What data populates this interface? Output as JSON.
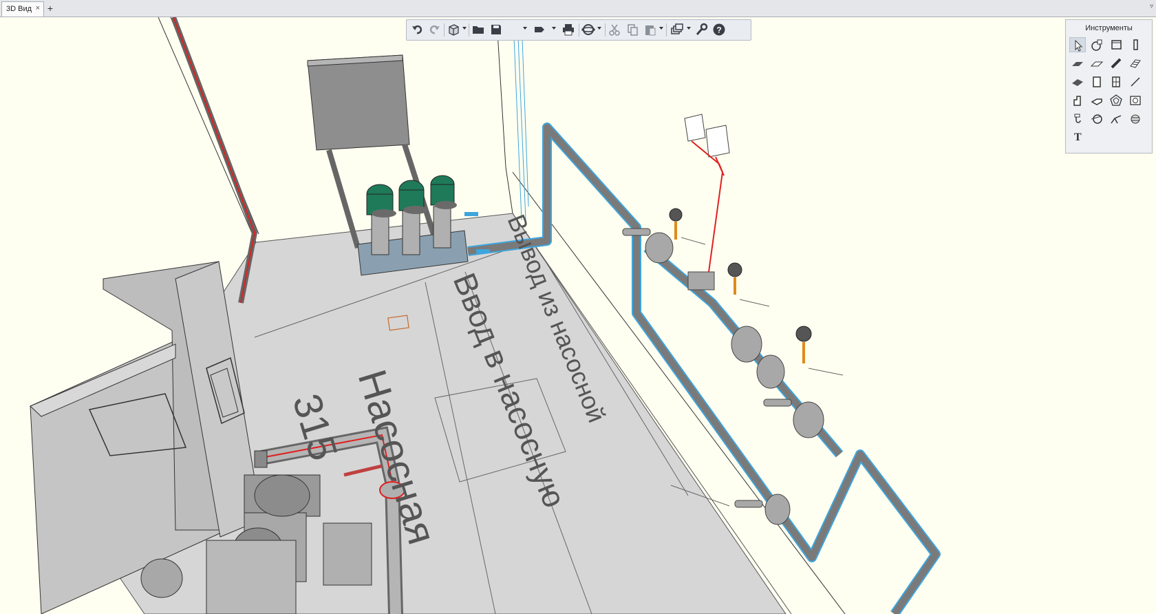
{
  "tabs": [
    {
      "label": "3D Вид",
      "close": "×"
    }
  ],
  "tab_add": "+",
  "tab_menu": "▿",
  "toolbar": {
    "buttons": [
      {
        "name": "undo-icon"
      },
      {
        "name": "redo-icon"
      },
      {
        "name": "view-cube-icon"
      },
      {
        "name": "open-folder-icon"
      },
      {
        "name": "save-icon"
      },
      {
        "name": "export-icon"
      },
      {
        "name": "print-icon"
      },
      {
        "name": "orbit-icon"
      },
      {
        "name": "cut-icon"
      },
      {
        "name": "copy-icon"
      },
      {
        "name": "paste-icon"
      },
      {
        "name": "layers-icon"
      },
      {
        "name": "settings-wrench-icon"
      },
      {
        "name": "help-icon"
      }
    ]
  },
  "tools_panel": {
    "title": "Инструменты",
    "text_tool": "T"
  },
  "scene": {
    "floor_labels": {
      "outlet": "Вывод из насосной",
      "inlet": "Ввод в насосную",
      "room_name": "Насосная",
      "room_number": "315"
    }
  },
  "colors": {
    "background": "#fffff1",
    "floor": "#d6d6d6",
    "equipment": "#9a9a9a",
    "pipe_highlight": "#3ea5dd",
    "pipe_red": "#e02020",
    "motor_green": "#1f7a5a"
  }
}
